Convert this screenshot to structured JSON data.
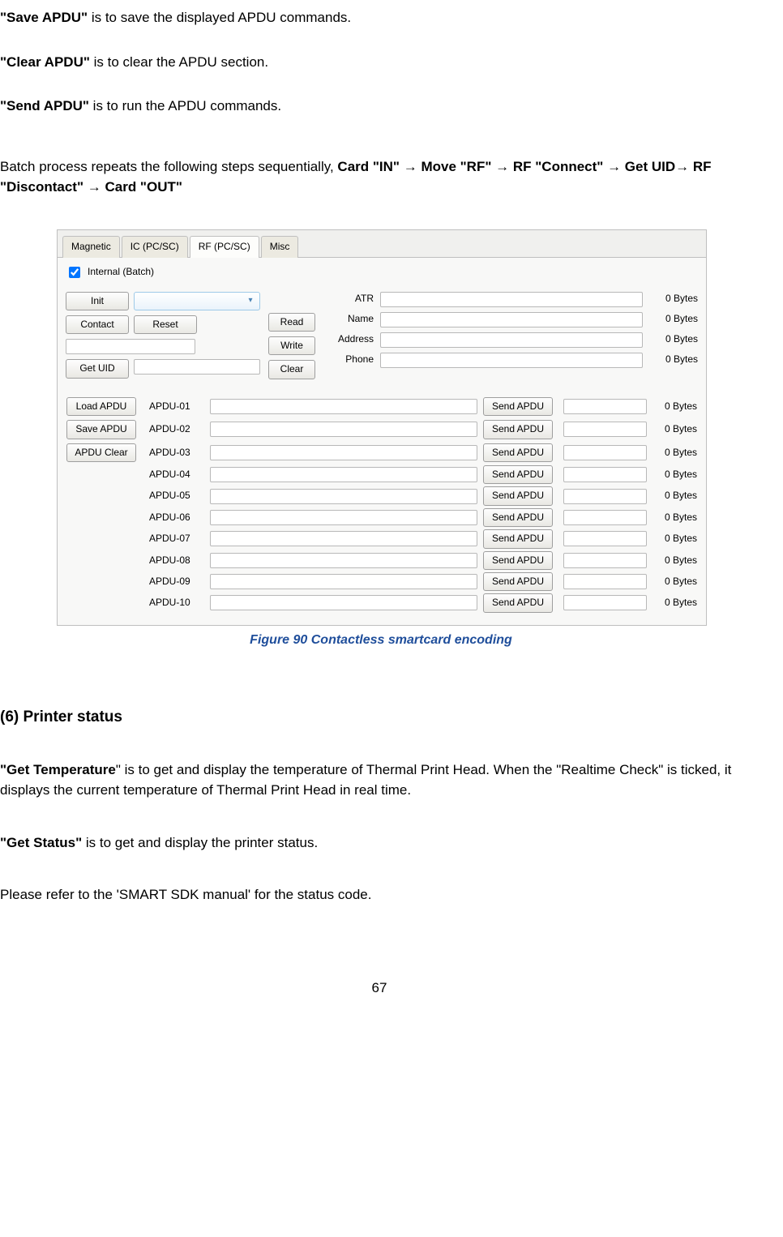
{
  "top_paragraphs": {
    "save_apdu_bold": "\"Save APDU\"",
    "save_apdu_rest": " is to save the displayed APDU commands.",
    "clear_apdu_bold": "\"Clear APDU\"",
    "clear_apdu_rest": " is to clear the APDU section.",
    "send_apdu_bold": "\"Send APDU\"",
    "send_apdu_rest": " is to run the APDU commands.",
    "batch_lead": "Batch process repeats the following steps sequentially, ",
    "batch_seq": "Card \"IN\" → Move \"RF\" → RF \"Connect\" → Get UID→ RF \"Discontact\" → Card \"OUT\""
  },
  "tabs": {
    "magnetic": "Magnetic",
    "ic": "IC (PC/SC)",
    "rf": "RF (PC/SC)",
    "misc": "Misc"
  },
  "panel": {
    "internal_batch": "Internal (Batch)",
    "init": "Init",
    "contact": "Contact",
    "reset": "Reset",
    "get_uid": "Get UID",
    "read": "Read",
    "write": "Write",
    "clear": "Clear",
    "fields": {
      "atr": "ATR",
      "name": "Name",
      "address": "Address",
      "phone": "Phone"
    },
    "bytes": "0 Bytes",
    "load_apdu": "Load APDU",
    "save_apdu": "Save APDU",
    "apdu_clear": "APDU Clear",
    "send_apdu": "Send APDU",
    "apdu_rows": [
      "APDU-01",
      "APDU-02",
      "APDU-03",
      "APDU-04",
      "APDU-05",
      "APDU-06",
      "APDU-07",
      "APDU-08",
      "APDU-09",
      "APDU-10"
    ]
  },
  "fig_caption": "Figure 90 Contactless smartcard encoding",
  "section6": {
    "heading": "(6) Printer status",
    "get_temp_bold": "\"Get Temperature",
    "get_temp_rest": "\" is to get and display the temperature of Thermal Print Head. When the \"Realtime Check\" is ticked, it displays the current temperature of Thermal Print Head in real time.",
    "get_status_bold": "\"Get Status\"",
    "get_status_rest": " is to get and display the printer status.",
    "refer": "Please refer to the 'SMART SDK manual' for the status code."
  },
  "page_number": "67"
}
